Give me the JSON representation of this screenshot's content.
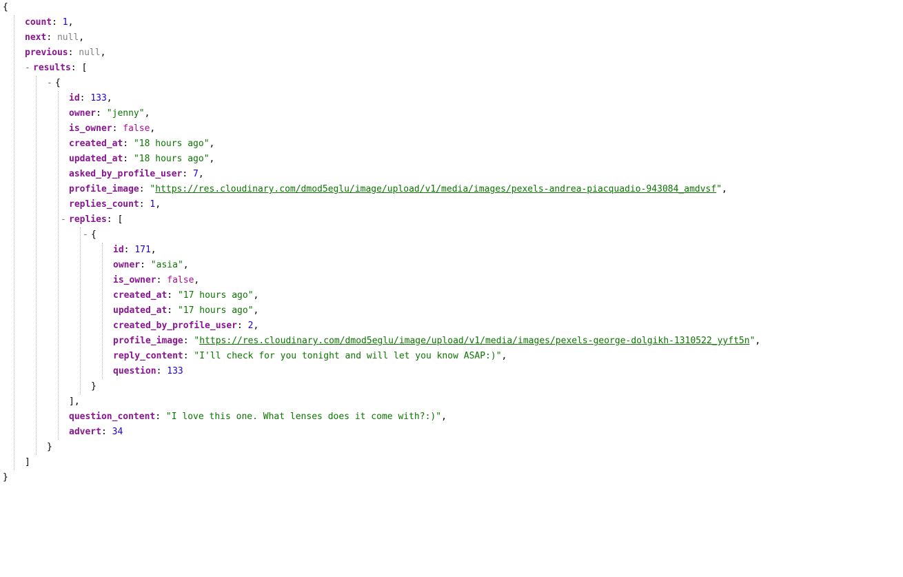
{
  "root_open": "{",
  "count_key": "count",
  "count_val": "1",
  "next_key": "next",
  "next_val": "null",
  "previous_key": "previous",
  "previous_val": "null",
  "results_key": "results",
  "results_open": "[",
  "results_item_open": "{",
  "id_key": "id",
  "id_val": "133",
  "owner_key": "owner",
  "owner_val": "jenny",
  "is_owner_key": "is_owner",
  "is_owner_val": "false",
  "created_at_key": "created_at",
  "created_at_val": "18 hours ago",
  "updated_at_key": "updated_at",
  "updated_at_val": "18 hours ago",
  "asked_by_key": "asked_by_profile_user",
  "asked_by_val": "7",
  "profile_image_key": "profile_image",
  "profile_image_val": "https://res.cloudinary.com/dmod5eglu/image/upload/v1/media/images/pexels-andrea-piacquadio-943084_amdvsf",
  "replies_count_key": "replies_count",
  "replies_count_val": "1",
  "replies_key": "replies",
  "replies_open": "[",
  "reply_item_open": "{",
  "reply_id_key": "id",
  "reply_id_val": "171",
  "reply_owner_key": "owner",
  "reply_owner_val": "asia",
  "reply_is_owner_key": "is_owner",
  "reply_is_owner_val": "false",
  "reply_created_at_key": "created_at",
  "reply_created_at_val": "17 hours ago",
  "reply_updated_at_key": "updated_at",
  "reply_updated_at_val": "17 hours ago",
  "reply_created_by_key": "created_by_profile_user",
  "reply_created_by_val": "2",
  "reply_profile_image_key": "profile_image",
  "reply_profile_image_val": "https://res.cloudinary.com/dmod5eglu/image/upload/v1/media/images/pexels-george-dolgikh-1310522_yyft5n",
  "reply_content_key": "reply_content",
  "reply_content_val": "I'll check for you tonight and will let you know ASAP:)",
  "reply_question_key": "question",
  "reply_question_val": "133",
  "reply_item_close": "}",
  "replies_close": "],",
  "question_content_key": "question_content",
  "question_content_val": "I love this one. What lenses does it come with?:)",
  "advert_key": "advert",
  "advert_val": "34",
  "results_item_close": "}",
  "results_close": "]",
  "root_close": "}",
  "toggle_collapse": "-"
}
